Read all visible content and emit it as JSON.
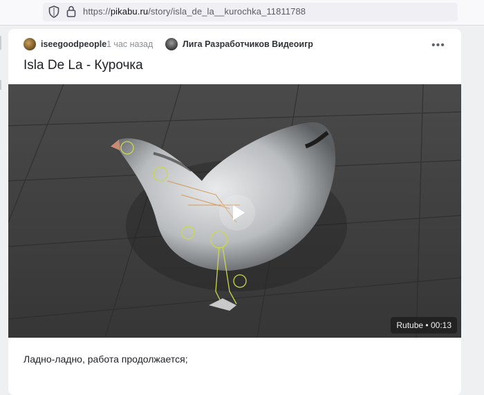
{
  "browser": {
    "url_prefix": "https://",
    "url_host": "pikabu.ru",
    "url_path": "/story/isla_de_la__kurochka_11811788"
  },
  "story": {
    "author": "iseegoodpeople",
    "time": "1 час назад",
    "community": "Лига Разработчиков Видеоигр",
    "title": "Isla De La - Курочка",
    "text": "Ладно-ладно, работа продолжается;",
    "video": {
      "provider": "Rutube",
      "separator": "•",
      "duration": "00:13"
    }
  },
  "icons": {
    "shield": "shield-icon",
    "lock": "lock-icon",
    "more": "more-icon",
    "play": "play-icon"
  }
}
